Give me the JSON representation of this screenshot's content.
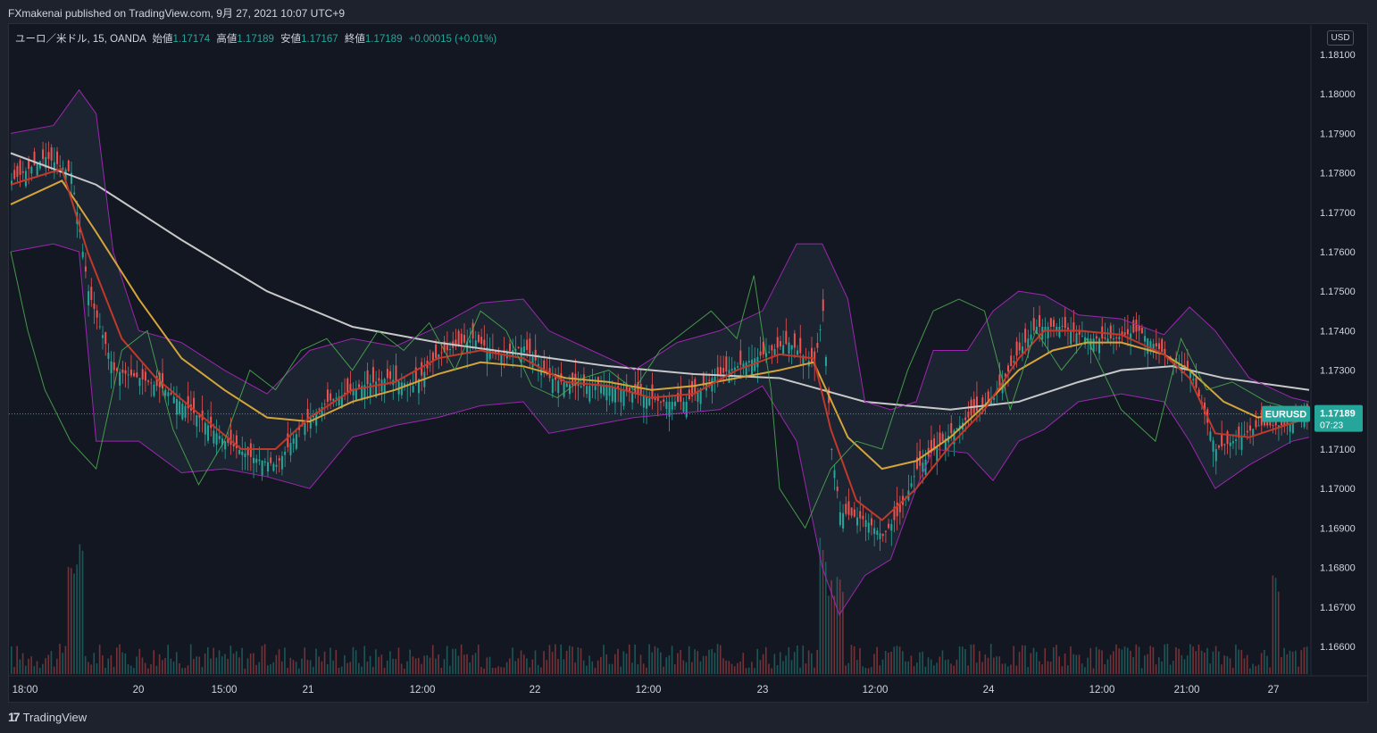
{
  "publisher_line": "FXmakenai published on TradingView.com, 9月 27, 2021 10:07 UTC+9",
  "legend": {
    "symbol": "ユーロ／米ドル, 15, OANDA",
    "open_label": "始値",
    "open": "1.17174",
    "high_label": "高値",
    "high": "1.17189",
    "low_label": "安値",
    "low": "1.17167",
    "close_label": "終値",
    "close": "1.17189",
    "change": "+0.00015 (+0.01%)"
  },
  "currency_button": "USD",
  "price_tag": {
    "symbol": "EURUSD",
    "price": "1.17189",
    "countdown": "07:23"
  },
  "footer": {
    "brand": "TradingView",
    "icon": "tradingview-logo-icon"
  },
  "colors": {
    "up": "#26a69a",
    "down": "#ef5350",
    "background": "#131722",
    "ma200": "#c8c8c8",
    "bb": "#9c27b0",
    "green_line": "#4caf50"
  },
  "chart_data": {
    "type": "candlestick",
    "symbol": "EURUSD",
    "timeframe": "15",
    "ylim": [
      1.1655,
      1.1815
    ],
    "y_ticks": [
      "1.18100",
      "1.18000",
      "1.17900",
      "1.17800",
      "1.17700",
      "1.17600",
      "1.17500",
      "1.17400",
      "1.17300",
      "1.17200",
      "1.17100",
      "1.17000",
      "1.16900",
      "1.16800",
      "1.16700",
      "1.16600"
    ],
    "x_ticks": [
      "18:00",
      "20",
      "15:00",
      "21",
      "12:00",
      "22",
      "12:00",
      "23",
      "12:00",
      "24",
      "12:00",
      "21:00",
      "27"
    ],
    "grid": false,
    "close_path": [
      [
        0,
        1.1778
      ],
      [
        4,
        1.1784
      ],
      [
        7,
        1.178
      ],
      [
        9,
        1.175
      ],
      [
        12,
        1.173
      ],
      [
        15,
        1.1728
      ],
      [
        18,
        1.1725
      ],
      [
        22,
        1.1718
      ],
      [
        25,
        1.1712
      ],
      [
        28,
        1.1708
      ],
      [
        31,
        1.1706
      ],
      [
        34,
        1.1716
      ],
      [
        37,
        1.1722
      ],
      [
        41,
        1.1726
      ],
      [
        44,
        1.1728
      ],
      [
        47,
        1.1726
      ],
      [
        50,
        1.1734
      ],
      [
        54,
        1.1738
      ],
      [
        57,
        1.1734
      ],
      [
        60,
        1.1736
      ],
      [
        63,
        1.1728
      ],
      [
        66,
        1.1726
      ],
      [
        70,
        1.1726
      ],
      [
        73,
        1.1724
      ],
      [
        76,
        1.1722
      ],
      [
        79,
        1.1722
      ],
      [
        82,
        1.1728
      ],
      [
        85,
        1.1731
      ],
      [
        88,
        1.1734
      ],
      [
        91,
        1.1737
      ],
      [
        94,
        1.1731
      ],
      [
        95,
        1.1745
      ],
      [
        96,
        1.171
      ],
      [
        97,
        1.1694
      ],
      [
        100,
        1.1692
      ],
      [
        102,
        1.1688
      ],
      [
        104,
        1.1694
      ],
      [
        106,
        1.1705
      ],
      [
        109,
        1.1712
      ],
      [
        112,
        1.1718
      ],
      [
        115,
        1.1723
      ],
      [
        118,
        1.1735
      ],
      [
        120,
        1.1741
      ],
      [
        123,
        1.1741
      ],
      [
        126,
        1.1738
      ],
      [
        129,
        1.1738
      ],
      [
        132,
        1.174
      ],
      [
        135,
        1.1734
      ],
      [
        138,
        1.173
      ],
      [
        141,
        1.171
      ],
      [
        143,
        1.1712
      ],
      [
        146,
        1.1716
      ],
      [
        149,
        1.1716
      ],
      [
        152,
        1.1719
      ]
    ],
    "series": [
      {
        "name": "",
        "kind": "sma200",
        "color": "#c8c8c8",
        "points": [
          [
            0,
            1.1785
          ],
          [
            10,
            1.1777
          ],
          [
            20,
            1.1763
          ],
          [
            30,
            1.175
          ],
          [
            40,
            1.1741
          ],
          [
            50,
            1.1737
          ],
          [
            60,
            1.1734
          ],
          [
            70,
            1.1731
          ],
          [
            80,
            1.1729
          ],
          [
            90,
            1.1728
          ],
          [
            100,
            1.1722
          ],
          [
            110,
            1.172
          ],
          [
            118,
            1.1722
          ],
          [
            125,
            1.1727
          ],
          [
            130,
            1.173
          ],
          [
            136,
            1.1731
          ],
          [
            142,
            1.1728
          ],
          [
            152,
            1.1725
          ]
        ]
      },
      {
        "name": "",
        "kind": "bb_upper",
        "color": "#9c27b0",
        "points": [
          [
            0,
            1.179
          ],
          [
            5,
            1.1792
          ],
          [
            8,
            1.1801
          ],
          [
            10,
            1.1795
          ],
          [
            12,
            1.176
          ],
          [
            15,
            1.174
          ],
          [
            20,
            1.1737
          ],
          [
            25,
            1.173
          ],
          [
            30,
            1.1724
          ],
          [
            35,
            1.1735
          ],
          [
            40,
            1.1738
          ],
          [
            45,
            1.1736
          ],
          [
            50,
            1.1741
          ],
          [
            55,
            1.1747
          ],
          [
            60,
            1.1748
          ],
          [
            63,
            1.174
          ],
          [
            68,
            1.1735
          ],
          [
            73,
            1.173
          ],
          [
            78,
            1.1737
          ],
          [
            83,
            1.174
          ],
          [
            88,
            1.1745
          ],
          [
            92,
            1.1762
          ],
          [
            95,
            1.1762
          ],
          [
            98,
            1.1748
          ],
          [
            100,
            1.1722
          ],
          [
            103,
            1.172
          ],
          [
            106,
            1.1722
          ],
          [
            108,
            1.1735
          ],
          [
            112,
            1.1735
          ],
          [
            115,
            1.1745
          ],
          [
            118,
            1.175
          ],
          [
            121,
            1.1749
          ],
          [
            125,
            1.1744
          ],
          [
            130,
            1.1743
          ],
          [
            135,
            1.1739
          ],
          [
            138,
            1.1746
          ],
          [
            141,
            1.174
          ],
          [
            145,
            1.1728
          ],
          [
            150,
            1.1723
          ],
          [
            152,
            1.1722
          ]
        ]
      },
      {
        "name": "",
        "kind": "bb_lower",
        "color": "#9c27b0",
        "points": [
          [
            0,
            1.176
          ],
          [
            5,
            1.1762
          ],
          [
            8,
            1.176
          ],
          [
            10,
            1.1712
          ],
          [
            12,
            1.1712
          ],
          [
            15,
            1.1712
          ],
          [
            20,
            1.1704
          ],
          [
            25,
            1.1705
          ],
          [
            30,
            1.1703
          ],
          [
            35,
            1.17
          ],
          [
            40,
            1.1713
          ],
          [
            45,
            1.1716
          ],
          [
            50,
            1.1718
          ],
          [
            55,
            1.1721
          ],
          [
            60,
            1.1722
          ],
          [
            63,
            1.1714
          ],
          [
            68,
            1.1716
          ],
          [
            73,
            1.1718
          ],
          [
            78,
            1.1719
          ],
          [
            83,
            1.172
          ],
          [
            88,
            1.1726
          ],
          [
            92,
            1.1712
          ],
          [
            95,
            1.168
          ],
          [
            97,
            1.1668
          ],
          [
            100,
            1.1678
          ],
          [
            103,
            1.1682
          ],
          [
            106,
            1.17
          ],
          [
            108,
            1.171
          ],
          [
            112,
            1.1709
          ],
          [
            115,
            1.1702
          ],
          [
            118,
            1.1712
          ],
          [
            121,
            1.1715
          ],
          [
            125,
            1.1722
          ],
          [
            130,
            1.1724
          ],
          [
            135,
            1.1722
          ],
          [
            138,
            1.1712
          ],
          [
            141,
            1.17
          ],
          [
            145,
            1.1706
          ],
          [
            150,
            1.1712
          ],
          [
            152,
            1.1713
          ]
        ]
      },
      {
        "name": "",
        "kind": "ema_slow",
        "color": "#d4a43a",
        "points": [
          [
            0,
            1.1772
          ],
          [
            6,
            1.1778
          ],
          [
            10,
            1.1765
          ],
          [
            15,
            1.1748
          ],
          [
            20,
            1.1733
          ],
          [
            25,
            1.1725
          ],
          [
            30,
            1.1718
          ],
          [
            35,
            1.1717
          ],
          [
            40,
            1.1722
          ],
          [
            45,
            1.1725
          ],
          [
            50,
            1.1729
          ],
          [
            55,
            1.1732
          ],
          [
            60,
            1.1731
          ],
          [
            65,
            1.1728
          ],
          [
            70,
            1.1727
          ],
          [
            75,
            1.1725
          ],
          [
            80,
            1.1726
          ],
          [
            85,
            1.1728
          ],
          [
            90,
            1.173
          ],
          [
            94,
            1.1732
          ],
          [
            98,
            1.1713
          ],
          [
            102,
            1.1705
          ],
          [
            106,
            1.1707
          ],
          [
            110,
            1.1713
          ],
          [
            114,
            1.1721
          ],
          [
            118,
            1.173
          ],
          [
            122,
            1.1735
          ],
          [
            126,
            1.1737
          ],
          [
            130,
            1.1737
          ],
          [
            135,
            1.1734
          ],
          [
            138,
            1.173
          ],
          [
            142,
            1.1722
          ],
          [
            146,
            1.1718
          ],
          [
            152,
            1.172
          ]
        ]
      },
      {
        "name": "",
        "kind": "ema_fast",
        "color": "#c0392b",
        "points": [
          [
            0,
            1.1777
          ],
          [
            6,
            1.1781
          ],
          [
            9,
            1.176
          ],
          [
            13,
            1.1738
          ],
          [
            17,
            1.1728
          ],
          [
            22,
            1.1719
          ],
          [
            27,
            1.171
          ],
          [
            31,
            1.171
          ],
          [
            35,
            1.1718
          ],
          [
            40,
            1.1725
          ],
          [
            45,
            1.1727
          ],
          [
            50,
            1.1733
          ],
          [
            55,
            1.1735
          ],
          [
            60,
            1.1733
          ],
          [
            65,
            1.1727
          ],
          [
            70,
            1.1726
          ],
          [
            75,
            1.1723
          ],
          [
            80,
            1.1724
          ],
          [
            85,
            1.173
          ],
          [
            90,
            1.1734
          ],
          [
            94,
            1.1733
          ],
          [
            96,
            1.1715
          ],
          [
            99,
            1.1697
          ],
          [
            102,
            1.1692
          ],
          [
            106,
            1.17
          ],
          [
            110,
            1.1711
          ],
          [
            114,
            1.172
          ],
          [
            118,
            1.1733
          ],
          [
            121,
            1.174
          ],
          [
            125,
            1.174
          ],
          [
            130,
            1.1739
          ],
          [
            135,
            1.1734
          ],
          [
            138,
            1.1728
          ],
          [
            141,
            1.1714
          ],
          [
            145,
            1.1713
          ],
          [
            152,
            1.1718
          ]
        ]
      },
      {
        "name": "",
        "kind": "green_oscillator",
        "color": "#4caf50",
        "points": [
          [
            0,
            1.176
          ],
          [
            2,
            1.174
          ],
          [
            4,
            1.1725
          ],
          [
            7,
            1.1712
          ],
          [
            10,
            1.1705
          ],
          [
            13,
            1.1735
          ],
          [
            16,
            1.174
          ],
          [
            19,
            1.1715
          ],
          [
            22,
            1.1701
          ],
          [
            25,
            1.1712
          ],
          [
            28,
            1.173
          ],
          [
            31,
            1.1725
          ],
          [
            34,
            1.1735
          ],
          [
            37,
            1.1738
          ],
          [
            40,
            1.173
          ],
          [
            43,
            1.174
          ],
          [
            46,
            1.1735
          ],
          [
            49,
            1.1742
          ],
          [
            52,
            1.173
          ],
          [
            55,
            1.1745
          ],
          [
            58,
            1.174
          ],
          [
            61,
            1.1726
          ],
          [
            64,
            1.1723
          ],
          [
            67,
            1.1728
          ],
          [
            70,
            1.173
          ],
          [
            73,
            1.1725
          ],
          [
            76,
            1.1735
          ],
          [
            79,
            1.174
          ],
          [
            82,
            1.1745
          ],
          [
            85,
            1.1738
          ],
          [
            87,
            1.1754
          ],
          [
            89,
            1.1725
          ],
          [
            90,
            1.17
          ],
          [
            93,
            1.169
          ],
          [
            96,
            1.1705
          ],
          [
            99,
            1.1712
          ],
          [
            102,
            1.171
          ],
          [
            105,
            1.173
          ],
          [
            108,
            1.1745
          ],
          [
            111,
            1.1748
          ],
          [
            114,
            1.1745
          ],
          [
            117,
            1.172
          ],
          [
            120,
            1.174
          ],
          [
            123,
            1.173
          ],
          [
            126,
            1.1738
          ],
          [
            130,
            1.172
          ],
          [
            134,
            1.1712
          ],
          [
            137,
            1.1738
          ],
          [
            140,
            1.1725
          ],
          [
            143,
            1.1727
          ],
          [
            147,
            1.1722
          ],
          [
            152,
            1.1719
          ]
        ]
      }
    ],
    "volume_scale": "relative",
    "last_price": 1.17189
  }
}
